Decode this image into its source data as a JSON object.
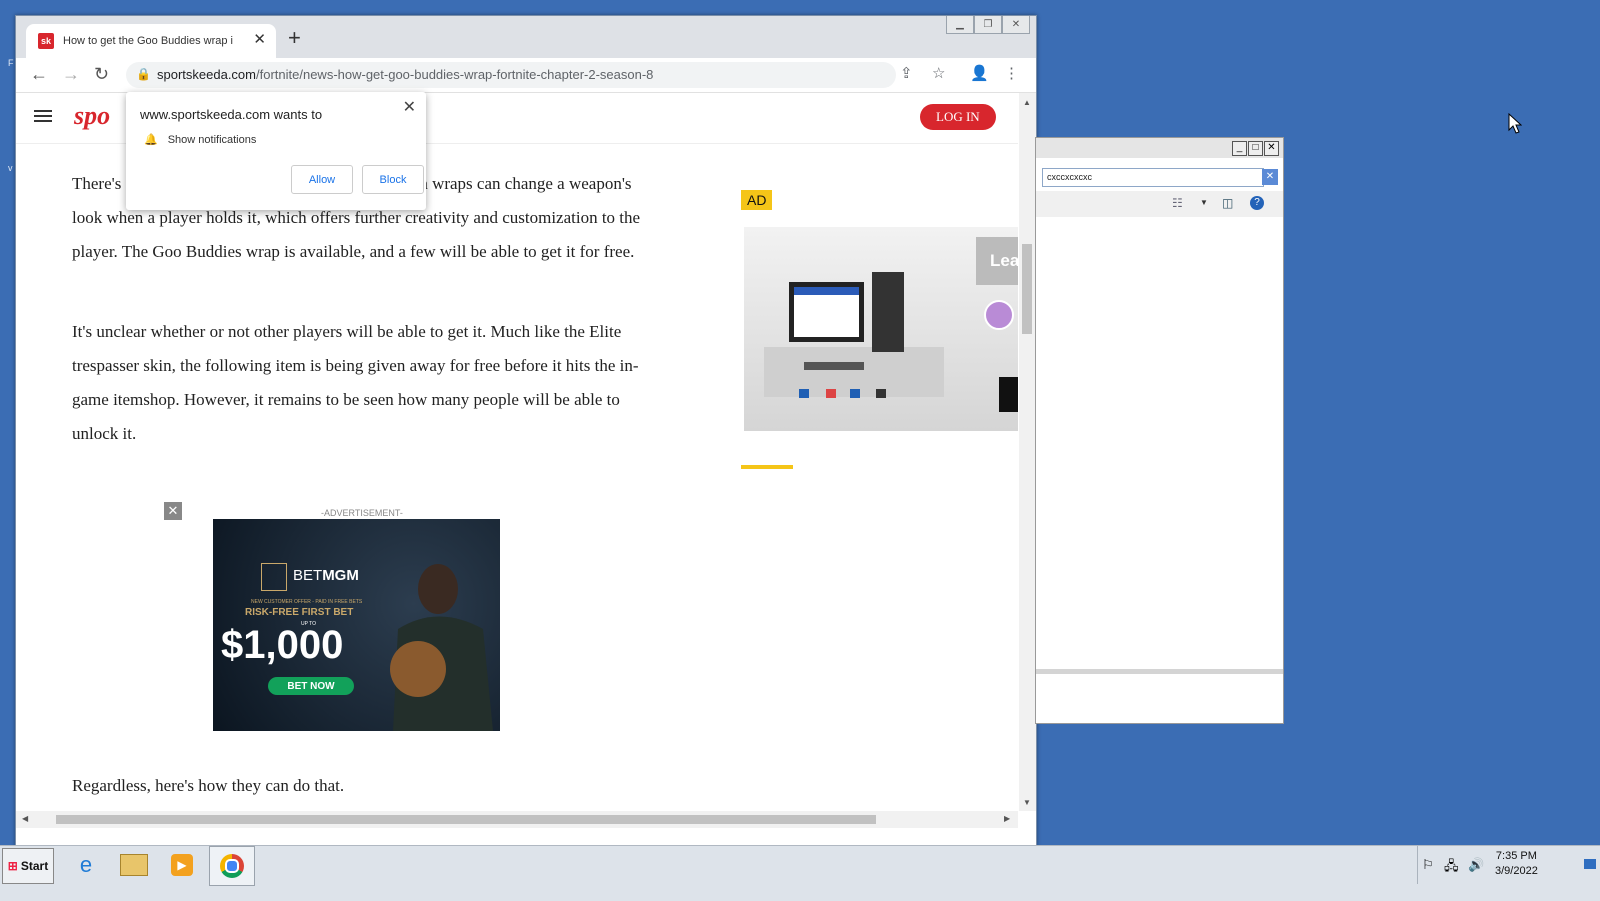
{
  "browser": {
    "tab_title": "How to get the Goo Buddies wrap in Fortnite",
    "favicon_text": "sk",
    "url_host": "sportskeeda.com",
    "url_path": "/fortnite/news-how-get-goo-buddies-wrap-fortnite-chapter-2-season-8"
  },
  "notification": {
    "title": "www.sportskeeda.com wants to",
    "item": "Show notifications",
    "allow_label": "Allow",
    "block_label": "Block"
  },
  "site": {
    "logo_text": "spo",
    "login_label": "LOG IN",
    "paragraphs": [
      "There's ... n wraps can change a weapon's look when a player holds it, which offers further creativity and customization to the player. The Goo Buddies wrap is available, and a few will be able to get it for free.",
      "It's unclear whether or not other players will be able to get it. Much like the Elite trespasser skin, the following item is being given away for free before it hits the in-game itemshop. However, it remains to be seen how many people will be able to unlock it.",
      "Regardless, here's how they can do that."
    ],
    "p1_lead": "There's",
    "p1_rest": "n wraps can change a",
    "p1_body": "weapon's look when a player holds it, which offers further creativity and customization to the player. The Goo Buddies wrap is available, and a few will be able to get it for free.",
    "ad_tag": "AD",
    "ad_side_text": "Lea",
    "advert_label": "-ADVERTISEMENT-",
    "betmgm": {
      "brand_a": "BET",
      "brand_b": "MGM",
      "offer_line": "NEW CUSTOMER OFFER - PAID IN FREE BETS",
      "headline": "RISK-FREE FIRST BET",
      "upto": "UP TO",
      "amount": "$1,000",
      "cta": "BET NOW"
    }
  },
  "side_window": {
    "search_value": "cxccxcxcxc"
  },
  "taskbar": {
    "start_label": "Start",
    "time": "7:35 PM",
    "date": "3/9/2022"
  },
  "colors": {
    "desktop": "#3b6db4",
    "brand_red": "#d8262d",
    "ad_yellow": "#f5c518"
  }
}
